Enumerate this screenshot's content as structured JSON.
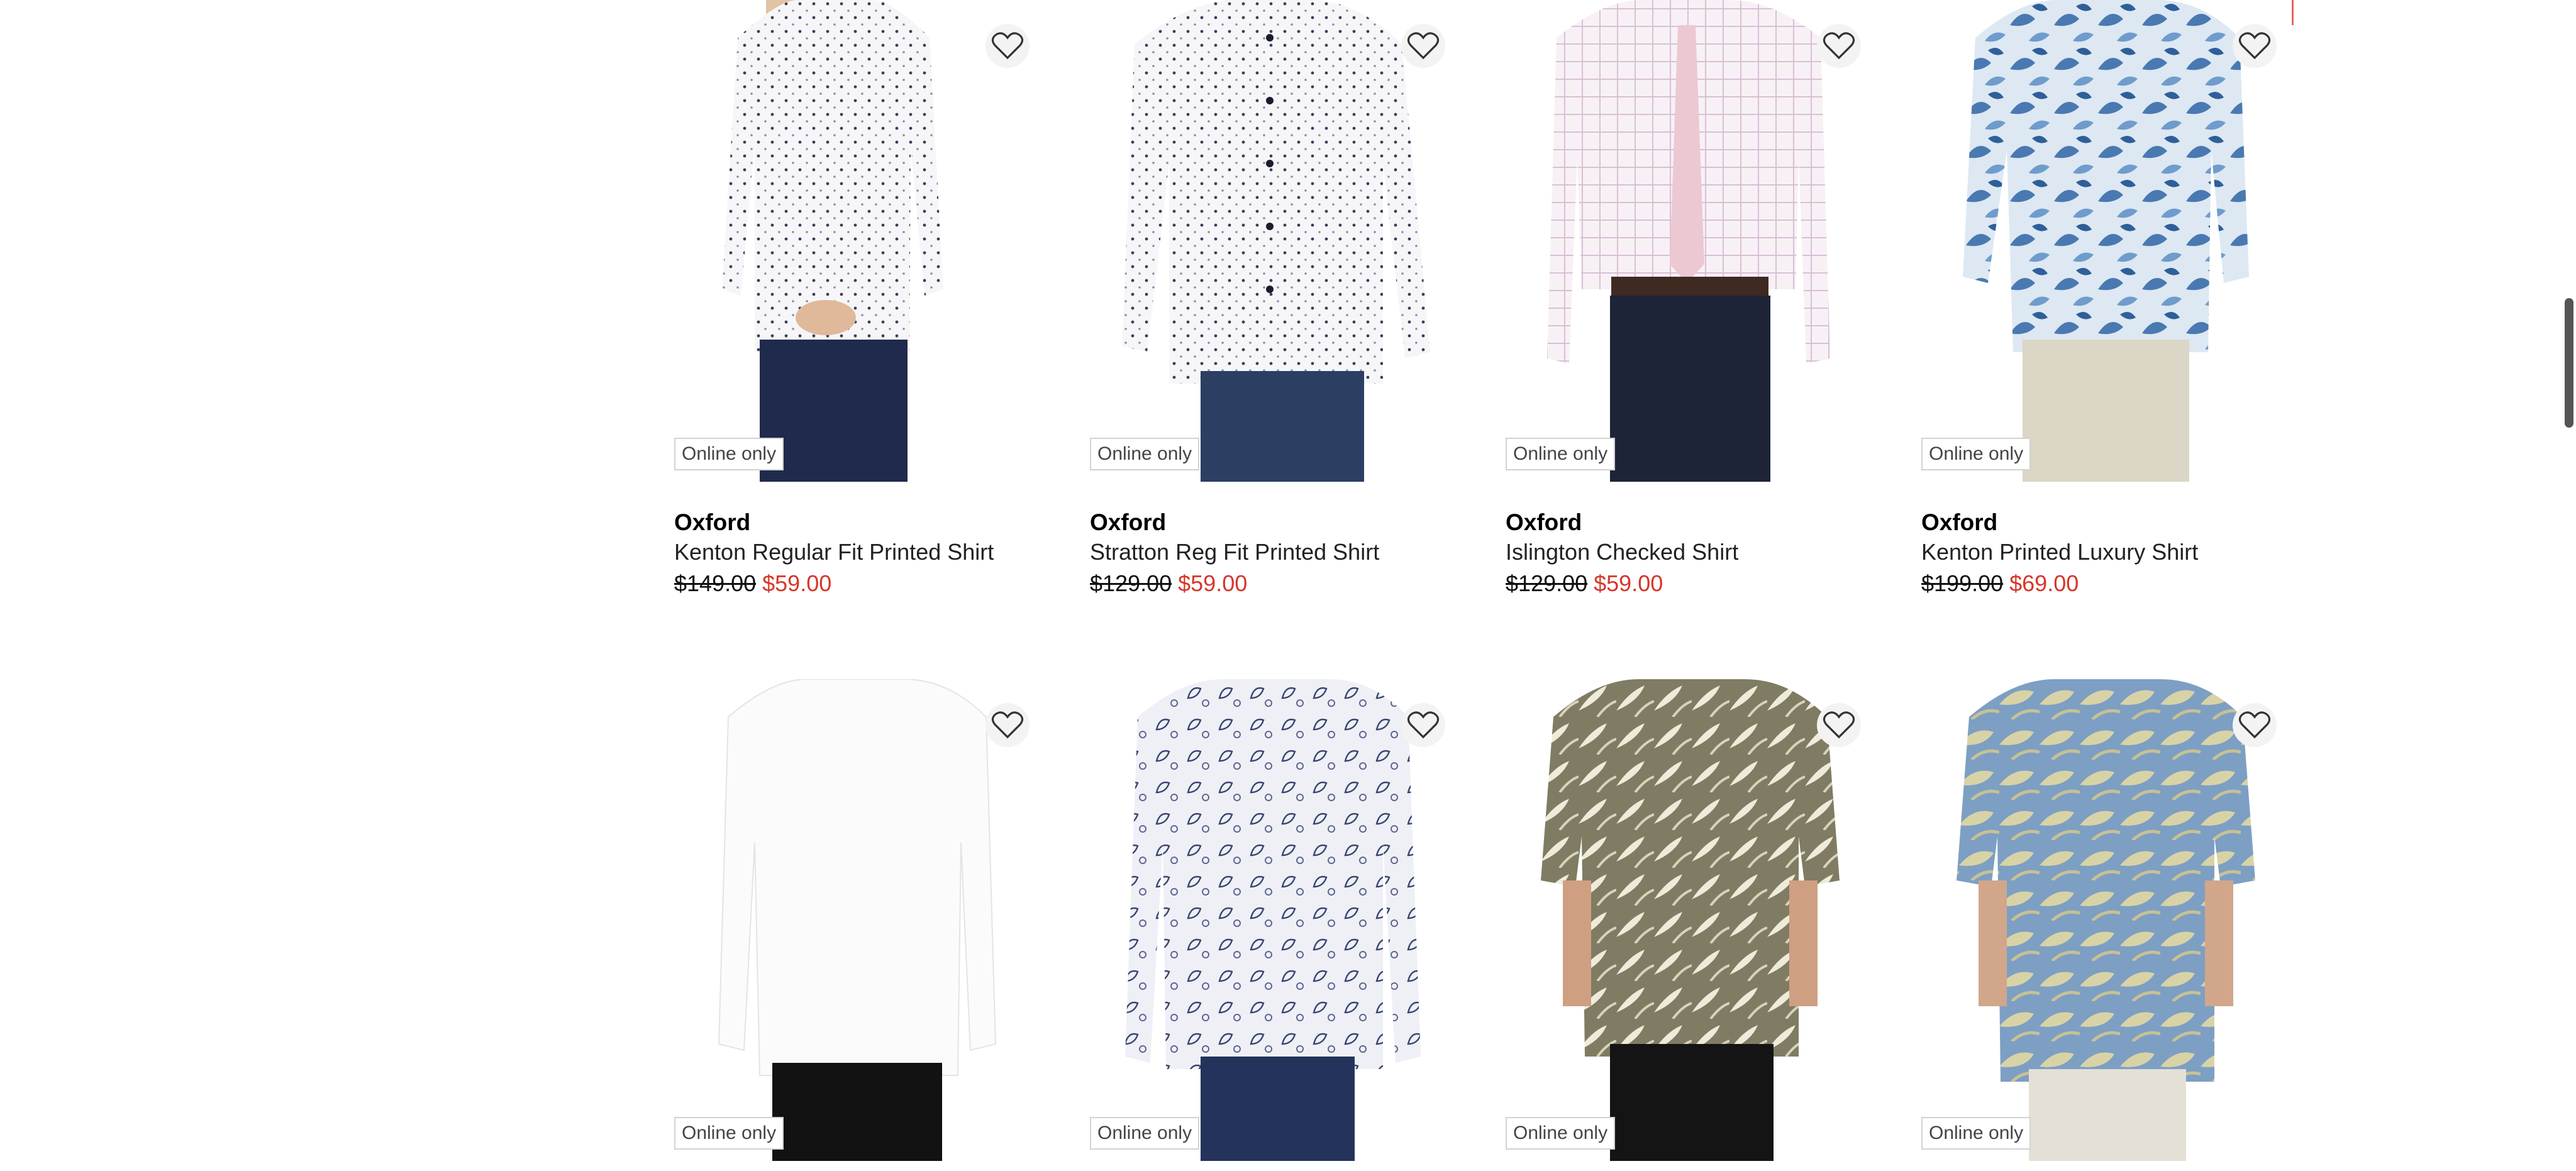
{
  "products_row1": [
    {
      "badge": "Online only",
      "brand": "Oxford",
      "name": "Kenton Regular Fit Printed Shirt",
      "was": "$149.00",
      "now": "$59.00"
    },
    {
      "badge": "Online only",
      "brand": "Oxford",
      "name": "Stratton Reg Fit Printed Shirt",
      "was": "$129.00",
      "now": "$59.00"
    },
    {
      "badge": "Online only",
      "brand": "Oxford",
      "name": "Islington Checked Shirt",
      "was": "$129.00",
      "now": "$59.00"
    },
    {
      "badge": "Online only",
      "brand": "Oxford",
      "name": "Kenton Printed Luxury Shirt",
      "was": "$199.00",
      "now": "$69.00"
    }
  ],
  "products_row2": [
    {
      "badge": "Online only"
    },
    {
      "badge": "Online only"
    },
    {
      "badge": "Online only"
    },
    {
      "badge": "Online only"
    }
  ],
  "colors": {
    "sale_price": "#d6362a",
    "selected_outline": "#e06a63"
  },
  "icons": {
    "wishlist": "heart-outline-icon"
  }
}
